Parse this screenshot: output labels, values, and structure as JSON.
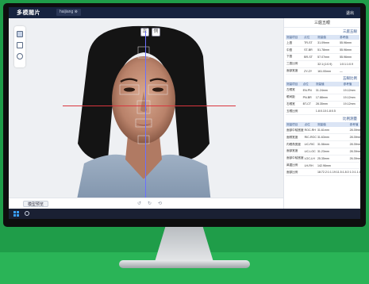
{
  "app": {
    "logo_text": "多模閥片",
    "project_tab": "haijiang  ⊗",
    "user_name": "退出"
  },
  "panel": {
    "title": "三庭五眼",
    "sections": [
      {
        "title": "三庭五眼",
        "headers": [
          "测量项目",
          "点位",
          "测量值",
          "参考值"
        ],
        "rows": [
          [
            "上庭",
            "TR-ST",
            "31.09mm",
            "55.96mm"
          ],
          [
            "中庭",
            "ST-BR",
            "51.78mm",
            "55.96mm"
          ],
          [
            "下庭",
            "BR-ST",
            "57.07mm",
            "55.96mm"
          ],
          [
            "三庭比例",
            "",
            "32:1:(1:0.9)",
            "1:0:1:1:0.9"
          ],
          [
            "面部宽度",
            "ZY-ZY",
            "161.00mm",
            "—"
          ]
        ]
      },
      {
        "title": "五眼比例",
        "headers": [
          "测量项目",
          "点位",
          "测量值",
          "参考值"
        ],
        "rows": [
          [
            "左眼宽",
            "EN-PN",
            "31.24mm",
            "19.12mm"
          ],
          [
            "眼间距",
            "PN-BR",
            "17.88mm",
            "19.12mm"
          ],
          [
            "右眼宽",
            "BT-CT",
            "28.35mm",
            "19.12mm"
          ],
          [
            "五眼比例",
            "",
            "1.8:0.10:1.8:0.5",
            ""
          ]
        ]
      },
      {
        "title": "比例测量",
        "headers": [
          "测量项目",
          "点位",
          "测量值",
          "参考值"
        ],
        "rows": [
          [
            "面部中轴宽度",
            "ROC-RH",
            "31.61mm",
            "28.39mm"
          ],
          [
            "面颊宽度",
            "RIC-ROC",
            "31.63mm",
            "28.39mm"
          ],
          [
            "内眼角宽度",
            "LIC-RIC",
            "31.56mm",
            "28.39mm"
          ],
          [
            "面部宽度",
            "LIC-LOC",
            "31.23mm",
            "28.39mm"
          ],
          [
            "面部中轴宽度",
            "LOC-LH",
            "25.35mm",
            "26.39mm"
          ],
          [
            "鼻翼比例",
            "LH-RH",
            "142.96mm",
            ""
          ],
          [
            "面部比例",
            "",
            "18:72.2:1:1.19:11.5:1.8.0",
            "1.0:1.1:1.0:1:1:0.11"
          ]
        ]
      }
    ]
  },
  "viewport": {
    "back_button": "模型预览",
    "rotate_icon": "↺",
    "redo_icon": "↻",
    "reset_icon": "⟲",
    "view_toggle_1": "正",
    "view_toggle_2": "侧"
  }
}
